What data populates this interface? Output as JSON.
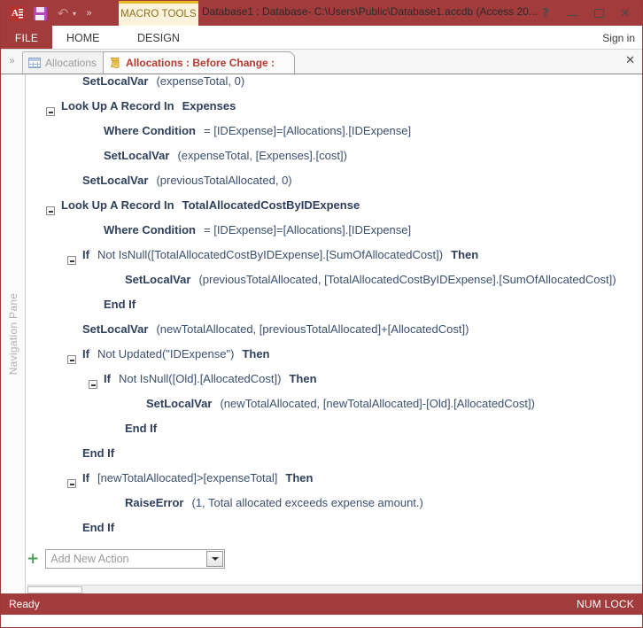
{
  "window": {
    "title": "Database1 : Database- C:\\Users\\Public\\Database1.accdb (Access 20...",
    "help_icon": "?",
    "minimize_icon": "minimize",
    "maximize_icon": "maximize",
    "close_icon": "✕",
    "signin_label": "Sign in"
  },
  "quick_access": {
    "logo_letter": "A",
    "save_icon": "save-icon",
    "undo_icon": "↶",
    "undo_caret": "▾",
    "more_icon": "»"
  },
  "ribbon": {
    "contextual_group": "MACRO TOOLS",
    "tabs": [
      {
        "label": "FILE",
        "active": true
      },
      {
        "label": "HOME",
        "active": false
      },
      {
        "label": "DESIGN",
        "active": false,
        "contextual": true
      }
    ]
  },
  "doc_tabs": {
    "nav_toggle_icon": "»",
    "close_icon": "✕",
    "items": [
      {
        "label": "Allocations",
        "icon": "table-icon",
        "active": false
      },
      {
        "label": "Allocations : Before Change :",
        "icon": "macro-scroll-icon",
        "active": true
      }
    ]
  },
  "navigation_pane": {
    "label": "Navigation Pane"
  },
  "macro": {
    "lines": [
      {
        "indent": 1,
        "collapse": "none",
        "kw": "SetLocalVar",
        "arg": "(expenseTotal, 0)"
      },
      {
        "indent": 0,
        "collapse": "minus",
        "kw": "Look Up A Record In",
        "argname": "Expenses"
      },
      {
        "indent": 2,
        "collapse": "none",
        "kw": "Where Condition",
        "arg": "= [IDExpense]=[Allocations].[IDExpense]"
      },
      {
        "indent": 2,
        "collapse": "none",
        "kw": "SetLocalVar",
        "arg": "(expenseTotal, [Expenses].[cost])"
      },
      {
        "indent": 1,
        "collapse": "none",
        "kw": "SetLocalVar",
        "arg": "(previousTotalAllocated, 0)"
      },
      {
        "indent": 0,
        "collapse": "minus",
        "kw": "Look Up A Record In",
        "argname": "TotalAllocatedCostByIDExpense"
      },
      {
        "indent": 2,
        "collapse": "none",
        "kw": "Where Condition",
        "arg": "= [IDExpense]=[Allocations].[IDExpense]"
      },
      {
        "indent": 1,
        "collapse": "minus",
        "kw": "If",
        "arg": "Not IsNull([TotalAllocatedCostByIDExpense].[SumOfAllocatedCost])",
        "kw2": "Then"
      },
      {
        "indent": 3,
        "collapse": "none",
        "kw": "SetLocalVar",
        "arg": "(previousTotalAllocated, [TotalAllocatedCostByIDExpense].[SumOfAllocatedCost])"
      },
      {
        "indent": 2,
        "collapse": "none",
        "kw": "End If"
      },
      {
        "indent": 1,
        "collapse": "none",
        "kw": "SetLocalVar",
        "arg": "(newTotalAllocated, [previousTotalAllocated]+[AllocatedCost])"
      },
      {
        "indent": 1,
        "collapse": "minus",
        "kw": "If",
        "arg": "Not Updated(\"IDExpense\")",
        "kw2": "Then"
      },
      {
        "indent": 2,
        "collapse": "minus",
        "kw": "If",
        "arg": "Not IsNull([Old].[AllocatedCost])",
        "kw2": "Then"
      },
      {
        "indent": 4,
        "collapse": "none",
        "kw": "SetLocalVar",
        "arg": "(newTotalAllocated, [newTotalAllocated]-[Old].[AllocatedCost])"
      },
      {
        "indent": 3,
        "collapse": "none",
        "kw": "End If"
      },
      {
        "indent": 1,
        "collapse": "none",
        "kw": "End If"
      },
      {
        "indent": 1,
        "collapse": "minus",
        "kw": "If",
        "arg": "[newTotalAllocated]>[expenseTotal]",
        "kw2": "Then"
      },
      {
        "indent": 3,
        "collapse": "none",
        "kw": "RaiseError",
        "arg": "(1, Total allocated exceeds expense amount.)"
      },
      {
        "indent": 1,
        "collapse": "none",
        "kw": "End If"
      }
    ],
    "add_action": {
      "plus_icon": "+",
      "placeholder": "Add New Action",
      "dropdown_icon": "chevron-down-icon"
    }
  },
  "status_bar": {
    "message": "Ready",
    "num_lock": "NUM LOCK"
  },
  "colors": {
    "accent": "#a23b3b",
    "contextual": "#e8b923",
    "macro_text": "#2d3f5c",
    "active_tab_text": "#b4392f"
  }
}
